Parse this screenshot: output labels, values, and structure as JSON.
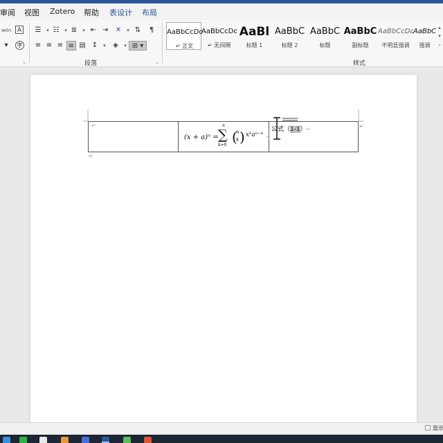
{
  "window": {
    "accent_color": "#2b579a"
  },
  "menu": {
    "tabs": [
      "审阅",
      "视图",
      "Zotero",
      "帮助",
      "表设计",
      "布局"
    ],
    "contextual_tab_color": "#2b579a"
  },
  "ribbon": {
    "groups": {
      "paragraph": "段落",
      "styles": "样式"
    },
    "font_group": {
      "phonetic_icon": "wén",
      "border_icon": "A",
      "encircle_icon": "字"
    },
    "styles": [
      {
        "sample": "AaBbCcDd",
        "name": "↵ 正文",
        "selected": true
      },
      {
        "sample": "AaBbCcDd",
        "name": "↵ 无间隔",
        "selected": false
      },
      {
        "sample": "AaBl",
        "name": "标题 1",
        "selected": false
      },
      {
        "sample": "AaBbC",
        "name": "标题 2",
        "selected": false
      },
      {
        "sample": "AaBbC",
        "name": "标题",
        "selected": false
      },
      {
        "sample": "AaBbC",
        "name": "副标题",
        "selected": false
      },
      {
        "sample": "AaBbCcDd",
        "name": "不明显强调",
        "selected": false
      },
      {
        "sample": "AaBbCcDd",
        "name": "强调",
        "selected": false
      }
    ]
  },
  "document": {
    "paragraph_mark": "↵",
    "formula": {
      "lhs": "(x + a)ⁿ =",
      "sum_top": "n",
      "sum_sign": "∑",
      "sum_bottom": "k=0",
      "binom_top": "n",
      "binom_bottom": "k",
      "term": "xᵏaⁿ⁻ᵏ"
    },
    "caption": {
      "prefix": "公式（",
      "number": "1-1",
      "suffix": "）"
    }
  },
  "status": {
    "right_text": "显示"
  }
}
